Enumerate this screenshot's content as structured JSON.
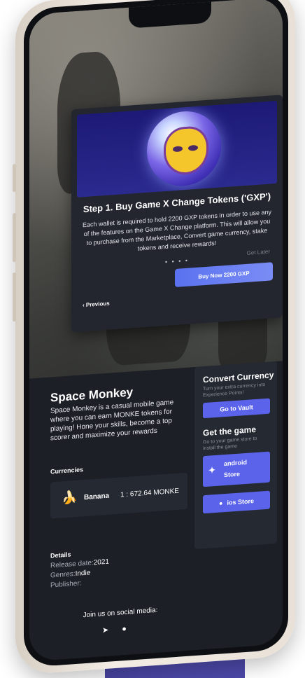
{
  "modal": {
    "title": "Step 1. Buy Game X Change Tokens ('GXP')",
    "body": "Each wallet is required to hold 2200 GXP tokens in order to use any of the features on the Game X Change platform. This will allow you to purchase from the Marketplace, Convert game currency, stake tokens and receive rewards!",
    "dots": "• • • •",
    "get_later": "Get Later",
    "buy_label": "Buy Now 2200 GXP",
    "previous_label": "Previous",
    "previous_icon": "chevron-left-icon"
  },
  "game": {
    "title": "Space Monkey",
    "description": "Space Monkey is a casual mobile game where you can earn MONKE tokens for playing! Hone your skills, become a top scorer and maximize your rewards",
    "currencies_label": "Currencies",
    "currency": {
      "icon": "banana-icon",
      "name": "Banana",
      "rate": "1 : 672.64 MONKE"
    },
    "details_label": "Details",
    "release_label": "Release date:",
    "release_value": "2021",
    "genres_label": "Genres:",
    "genres_value": "Indie",
    "publisher_label": "Publisher:",
    "social_label": "Join us on social media:",
    "social_icons": [
      "telegram-icon",
      "discord-icon"
    ]
  },
  "side": {
    "convert_title": "Convert Currency",
    "convert_desc": "Turn your extra currency into Experience Points!",
    "vault_button": "Go to Vault",
    "get_title": "Get the game",
    "get_desc": "Go to your game store to install the game",
    "android_line1": "android",
    "android_line2": "Store",
    "ios_label": "ios Store"
  },
  "colors": {
    "accent": "#5a63ea",
    "background": "#1c1f26",
    "banner": "#1d1a76"
  }
}
